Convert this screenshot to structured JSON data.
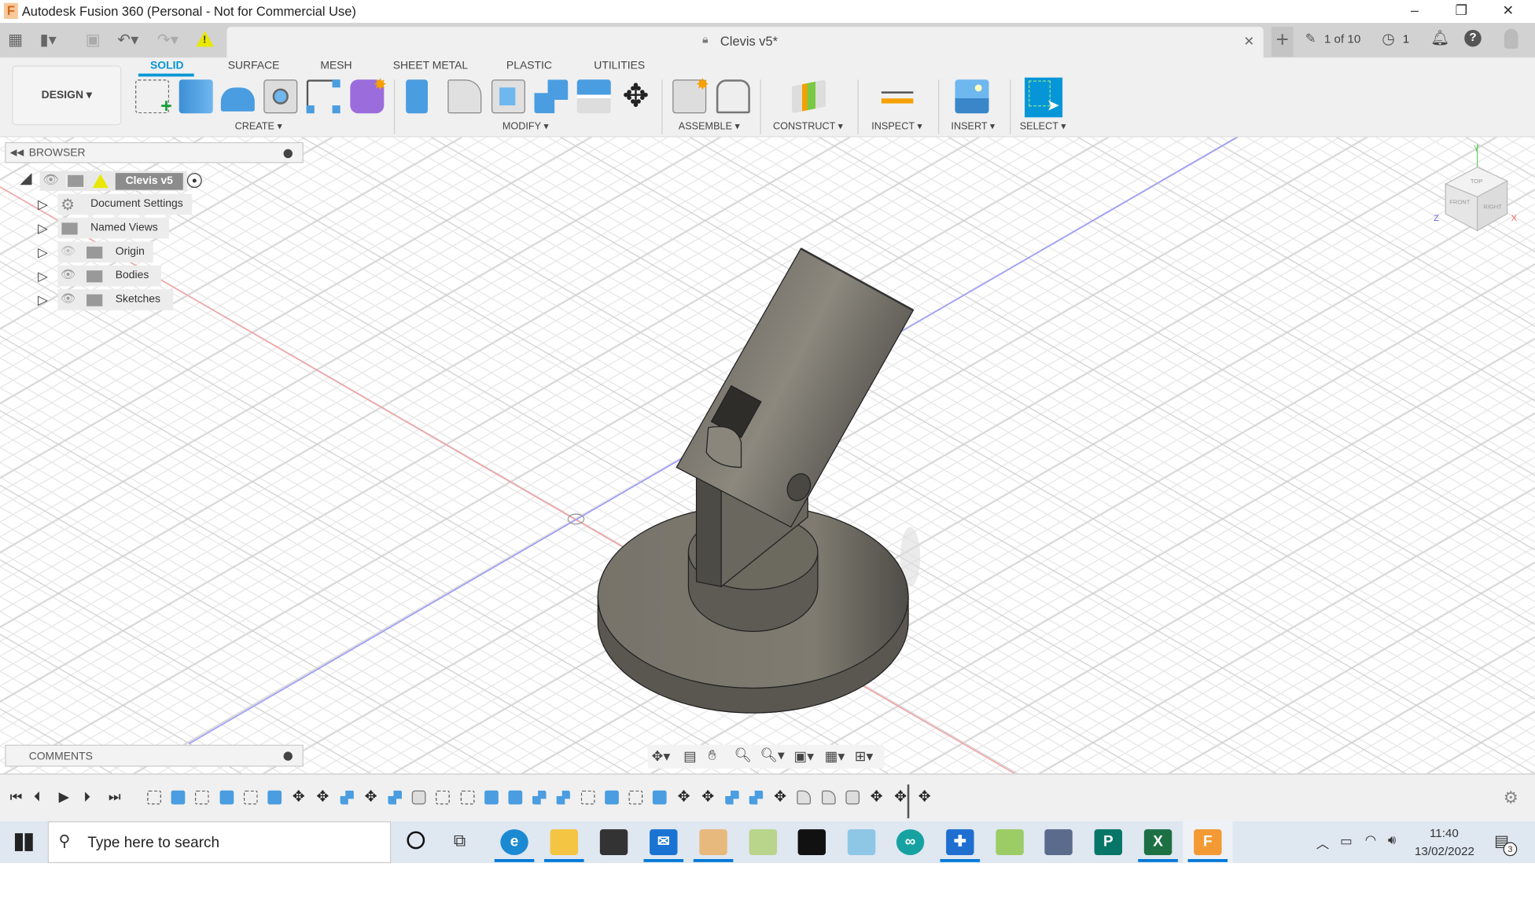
{
  "app": {
    "title": "Autodesk Fusion 360 (Personal - Not for Commercial Use)",
    "logo": "F"
  },
  "window": {
    "minimize": "–",
    "restore": "❐",
    "close": "✕"
  },
  "quick_access": {
    "warning": "!"
  },
  "doc_tab": {
    "title": "Clevis v5*",
    "close": "✕",
    "new_tab": "+"
  },
  "status": {
    "jobs": "1 of 10",
    "history": "1"
  },
  "ribbon": {
    "mode": "DESIGN ▾",
    "tabs": [
      "SOLID",
      "SURFACE",
      "MESH",
      "SHEET METAL",
      "PLASTIC",
      "UTILITIES"
    ],
    "active_tab": "SOLID",
    "groups": [
      "CREATE ▾",
      "MODIFY ▾",
      "ASSEMBLE ▾",
      "CONSTRUCT ▾",
      "INSPECT ▾",
      "INSERT ▾",
      "SELECT ▾"
    ]
  },
  "browser": {
    "title": "BROWSER",
    "root": "Clevis v5",
    "items": [
      "Document Settings",
      "Named Views",
      "Origin",
      "Bodies",
      "Sketches"
    ]
  },
  "comments": {
    "title": "COMMENTS"
  },
  "viewcube": {
    "top": "TOP",
    "front": "FRONT",
    "right": "RIGHT",
    "x": "X",
    "y": "Y",
    "z": "Z"
  },
  "timeline": {
    "features": [
      "sketch",
      "extrude",
      "sketch",
      "extrude",
      "sketch",
      "extrude",
      "move",
      "move",
      "combine",
      "move",
      "combine",
      "hole",
      "sketch",
      "sketch",
      "extrude",
      "extrude",
      "combine",
      "combine",
      "sketch",
      "extrude",
      "sketch",
      "extrude",
      "move",
      "move",
      "combine",
      "combine",
      "move",
      "fillet",
      "fillet",
      "hole",
      "move",
      "move",
      "move"
    ]
  },
  "taskbar": {
    "search_placeholder": "Type here to search",
    "time": "11:40",
    "date": "13/02/2022",
    "notifications": "3"
  },
  "colors": {
    "accent": "#0696d7",
    "model": "#6e6b63",
    "x_axis": "#f08080",
    "z_axis": "#8080ff"
  }
}
